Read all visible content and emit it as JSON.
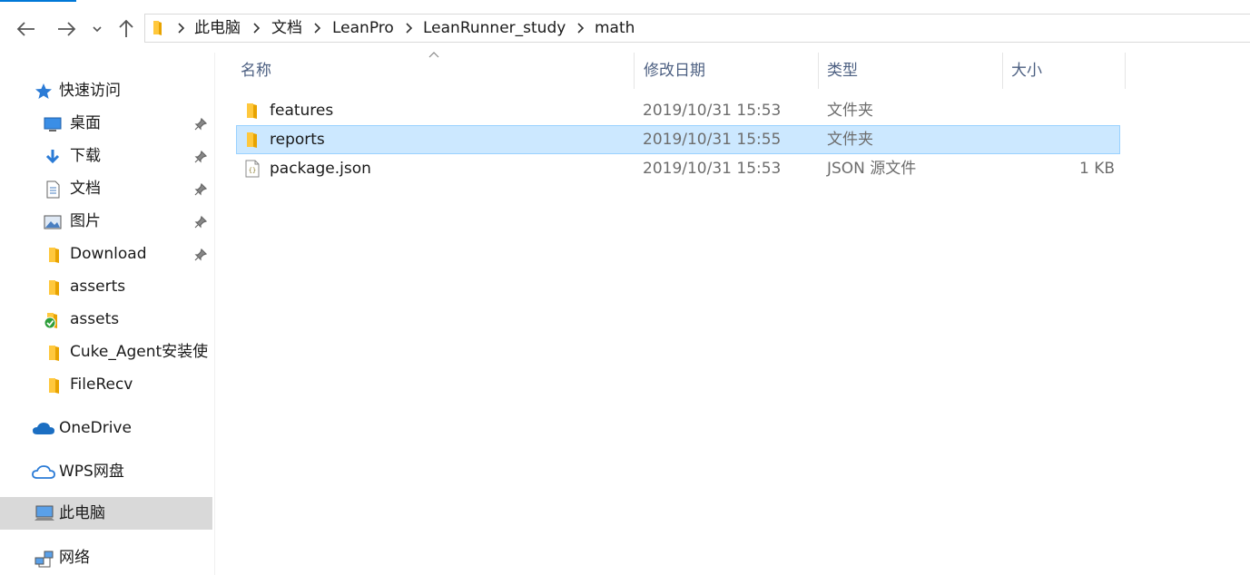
{
  "nav": {
    "path": [
      "此电脑",
      "文档",
      "LeanPro",
      "LeanRunner_study",
      "math"
    ]
  },
  "sidebar": {
    "quick_access": "快速访问",
    "items": [
      {
        "label": "桌面",
        "icon": "desktop-icon",
        "pinned": true
      },
      {
        "label": "下载",
        "icon": "download-icon",
        "pinned": true
      },
      {
        "label": "文档",
        "icon": "document-icon",
        "pinned": true
      },
      {
        "label": "图片",
        "icon": "pictures-icon",
        "pinned": true
      },
      {
        "label": "Download",
        "icon": "folder-icon",
        "pinned": true
      },
      {
        "label": "asserts",
        "icon": "folder-icon",
        "pinned": false
      },
      {
        "label": "assets",
        "icon": "folder-synced-icon",
        "pinned": false
      },
      {
        "label": "Cuke_Agent安装使",
        "icon": "folder-icon",
        "pinned": false
      },
      {
        "label": "FileRecv",
        "icon": "folder-icon",
        "pinned": false
      }
    ],
    "onedrive": "OneDrive",
    "wps": "WPS网盘",
    "this_pc": "此电脑",
    "network": "网络"
  },
  "columns": {
    "name": "名称",
    "date": "修改日期",
    "type": "类型",
    "size": "大小"
  },
  "files": [
    {
      "name": "features",
      "date": "2019/10/31 15:53",
      "type": "文件夹",
      "size": "",
      "icon": "folder-icon",
      "selected": false
    },
    {
      "name": "reports",
      "date": "2019/10/31 15:55",
      "type": "文件夹",
      "size": "",
      "icon": "folder-icon",
      "selected": true
    },
    {
      "name": "package.json",
      "date": "2019/10/31 15:53",
      "type": "JSON 源文件",
      "size": "1 KB",
      "icon": "json-file-icon",
      "selected": false
    }
  ],
  "colors": {
    "accent": "#0078d7",
    "folder": "#ffc83d",
    "selection": "#cce8ff",
    "selection_border": "#99d1ff",
    "header_text": "#4d6082",
    "sidebar_selected": "#d9d9d9"
  }
}
